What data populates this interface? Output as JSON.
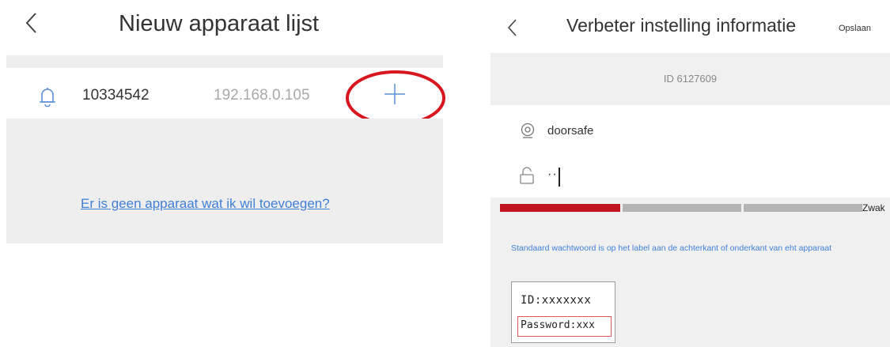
{
  "left": {
    "title": "Nieuw apparaat lijst",
    "device": {
      "id": "10334542",
      "ip": "192.168.0.105"
    },
    "link": "Er is geen apparaat wat ik wil toevoegen?",
    "icons": {
      "back": "chevron-left-icon",
      "bell": "bell-icon",
      "add": "plus-icon"
    },
    "highlight_color": "#d8161e"
  },
  "right": {
    "title": "Verbeter instelling informatie",
    "save_label": "Opslaan",
    "device_id": "ID 6127609",
    "name": "doorsafe",
    "password_masked": "··",
    "strength_label": "Zwak",
    "strength_segments": [
      {
        "color": "#c0141f"
      },
      {
        "color": "#b4b4b4"
      },
      {
        "color": "#b4b4b4"
      }
    ],
    "hint": "Standaard wachtwoord is op het label aan de achterkant of onderkant van eht apparaat",
    "label_card": {
      "id_line": "ID:xxxxxxx",
      "password_line": "Password:xxx"
    },
    "icons": {
      "back": "chevron-left-icon",
      "camera": "camera-icon",
      "lock": "lock-icon"
    }
  },
  "colors": {
    "accent": "#3f7fd8",
    "panel": "#eeeeee",
    "danger": "#c0141f"
  }
}
